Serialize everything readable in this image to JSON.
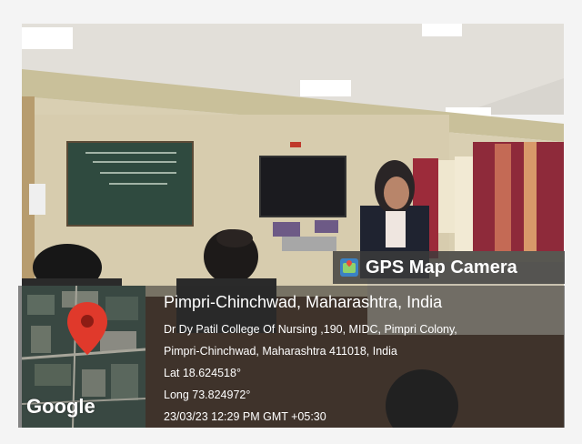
{
  "badge": {
    "label": "GPS Map Camera",
    "icon": "gps-map-camera-icon"
  },
  "location": {
    "city": "Pimpri-Chinchwad, Maharashtra, India",
    "address_line_1": "Dr Dy Patil College Of Nursing ,190, MIDC, Pimpri Colony,",
    "address_line_2": "Pimpri-Chinchwad, Maharashtra 411018, India",
    "latitude": "Lat 18.624518°",
    "longitude": "Long 73.824972°",
    "timestamp": "23/03/23 12:29 PM GMT +05:30"
  },
  "map": {
    "logo": "Google",
    "pin_icon": "map-pin-icon"
  },
  "colors": {
    "overlay": "#3c3c3c",
    "pin": "#e0392b",
    "text": "#ffffff"
  }
}
